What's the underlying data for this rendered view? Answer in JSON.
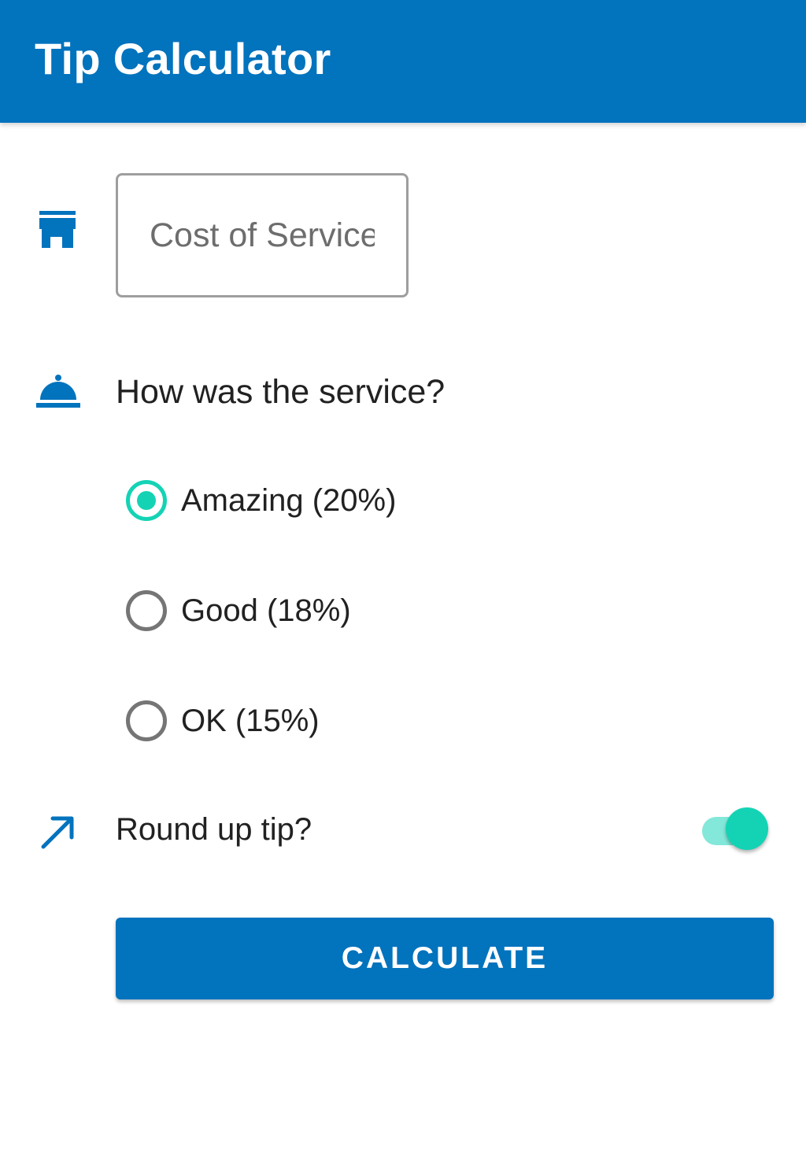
{
  "app_bar": {
    "title": "Tip Calculator",
    "background_color": "#0273bd"
  },
  "cost_of_service": {
    "icon": "storefront-icon",
    "placeholder": "Cost of Service",
    "value": ""
  },
  "service_question": {
    "icon": "room-service-icon",
    "label": "How was the service?",
    "options": [
      {
        "label": "Amazing (20%)",
        "checked": true
      },
      {
        "label": "Good (18%)",
        "checked": false
      },
      {
        "label": "OK (15%)",
        "checked": false
      }
    ]
  },
  "round_up": {
    "icon": "trending-up-arrow-icon",
    "label": "Round up tip?",
    "enabled": true
  },
  "calculate_button": {
    "label": "CALCULATE"
  },
  "colors": {
    "primary": "#0273bd",
    "accent": "#14d3b5",
    "accent_track": "#83e8d9",
    "text": "#212121"
  }
}
